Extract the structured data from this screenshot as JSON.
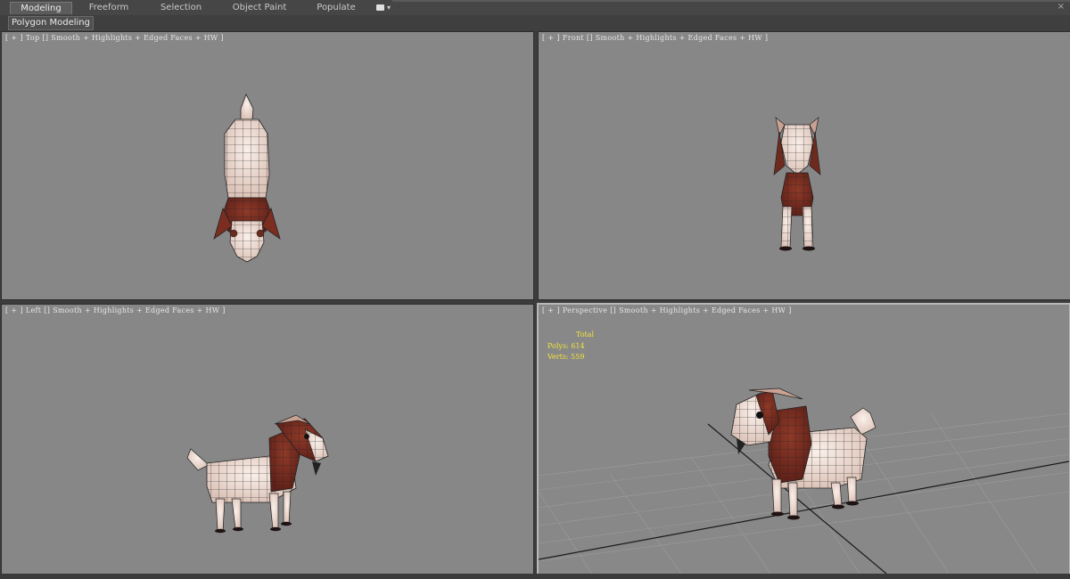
{
  "ribbon": {
    "tabs": [
      {
        "label": "Modeling",
        "active": true
      },
      {
        "label": "Freeform",
        "active": false
      },
      {
        "label": "Selection",
        "active": false
      },
      {
        "label": "Object Paint",
        "active": false
      },
      {
        "label": "Populate",
        "active": false
      }
    ],
    "sub_tab": "Polygon Modeling"
  },
  "viewports": {
    "top": {
      "bracket_open": "[",
      "plus": "+",
      "bracket_close": "]",
      "name": "Top",
      "bracket2": "[]",
      "mode": "Smooth + Highlights + Edged Faces + HW",
      "end": "]"
    },
    "front": {
      "bracket_open": "[",
      "plus": "+",
      "bracket_close": "]",
      "name": "Front",
      "bracket2": "[]",
      "mode": "Smooth + Highlights + Edged Faces + HW",
      "end": "]"
    },
    "left": {
      "bracket_open": "[",
      "plus": "+",
      "bracket_close": "]",
      "name": "Left",
      "bracket2": "[]",
      "mode": "Smooth + Highlights + Edged Faces + HW",
      "end": "]"
    },
    "perspective": {
      "bracket_open": "[",
      "plus": "+",
      "bracket_close": "]",
      "name": "Perspective",
      "bracket2": "[]",
      "mode": "Smooth + Highlights + Edged Faces + HW",
      "end": "]"
    }
  },
  "stats": {
    "title": "Total",
    "polys_label": "Polys:",
    "polys_value": "614",
    "verts_label": "Verts:",
    "verts_value": "559",
    "color": "#f2e23a"
  },
  "colors": {
    "viewport_bg": "#878787",
    "goat_white": "#efe2dc",
    "goat_brown": "#7a2f22",
    "wire": "#1a1a1a"
  }
}
